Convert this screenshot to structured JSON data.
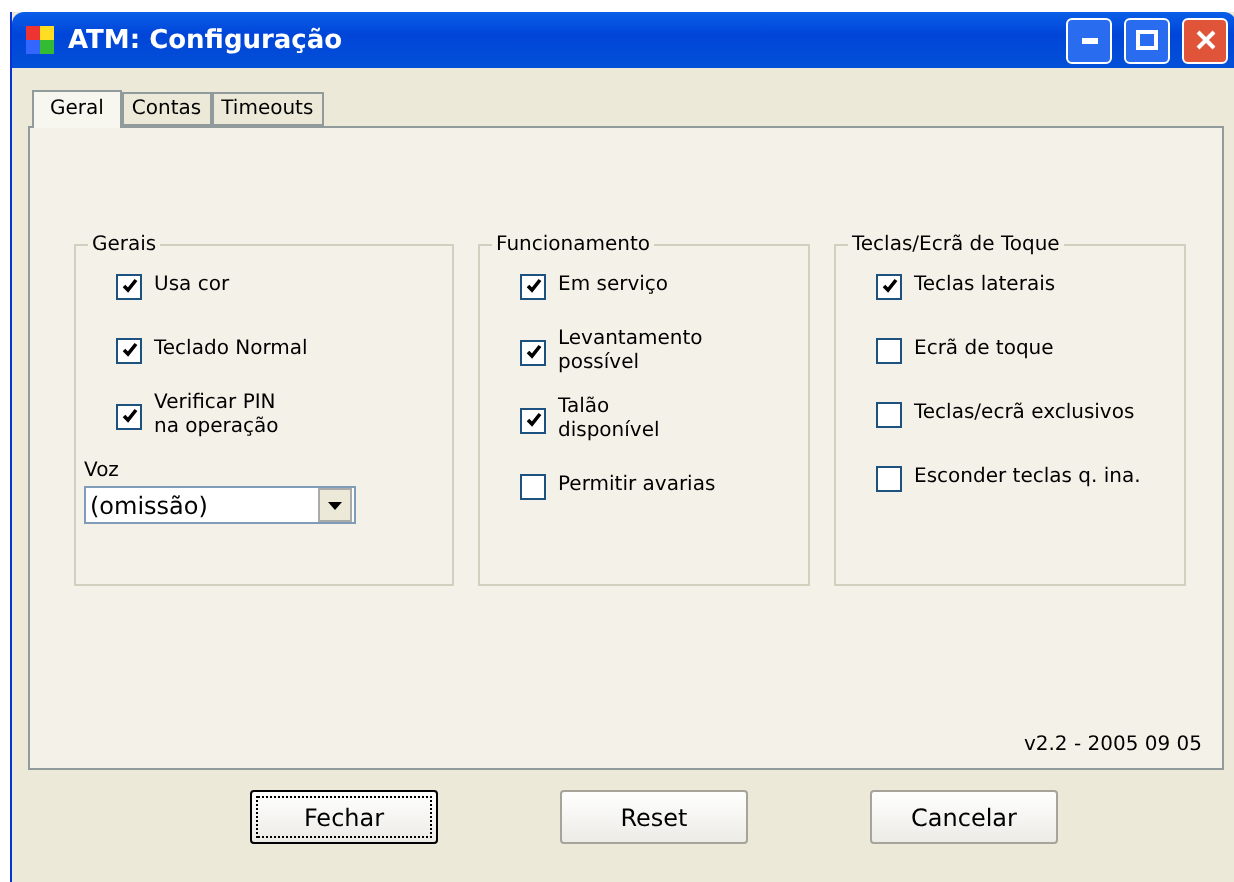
{
  "window": {
    "title": "ATM: Configuração"
  },
  "tabs": [
    {
      "label": "Geral",
      "selected": true
    },
    {
      "label": "Contas",
      "selected": false
    },
    {
      "label": "Timeouts",
      "selected": false
    }
  ],
  "groups": [
    {
      "title": "Gerais",
      "items": [
        {
          "label": "Usa cor",
          "checked": true
        },
        {
          "label": "Teclado Normal",
          "checked": true
        },
        {
          "label": "Verificar PIN\nna operação",
          "checked": true
        }
      ],
      "dropdown": {
        "label": "Voz",
        "value": "(omissão)"
      }
    },
    {
      "title": "Funcionamento",
      "items": [
        {
          "label": "Em serviço",
          "checked": true
        },
        {
          "label": "Levantamento\npossível",
          "checked": true
        },
        {
          "label": "Talão\ndisponível",
          "checked": true
        },
        {
          "label": "Permitir avarias",
          "checked": false
        }
      ]
    },
    {
      "title": "Teclas/Ecrã de Toque",
      "items": [
        {
          "label": "Teclas laterais",
          "checked": true
        },
        {
          "label": "Ecrã de toque",
          "checked": false
        },
        {
          "label": "Teclas/ecrã exclusivos",
          "checked": false
        },
        {
          "label": "Esconder teclas q. ina.",
          "checked": false
        }
      ]
    }
  ],
  "version": "v2.2 - 2005 09 05",
  "buttons": [
    {
      "label": "Fechar",
      "selected": true
    },
    {
      "label": "Reset",
      "selected": false
    },
    {
      "label": "Cancelar",
      "selected": false
    }
  ]
}
